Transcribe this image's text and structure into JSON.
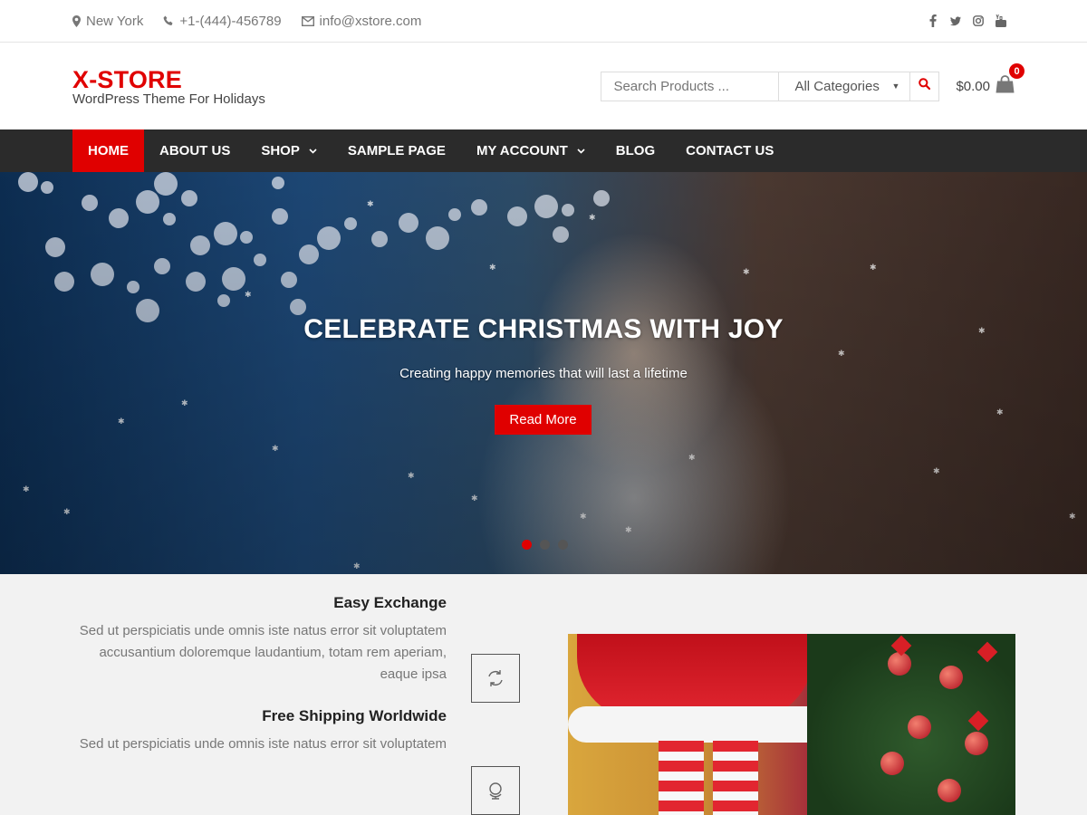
{
  "topbar": {
    "location": "New York",
    "phone": "+1-(444)-456789",
    "email": "info@xstore.com",
    "social": [
      "facebook-icon",
      "twitter-icon",
      "instagram-icon",
      "youtube-icon"
    ]
  },
  "header": {
    "logo": "X-STORE",
    "tagline": "WordPress Theme For Holidays",
    "search_placeholder": "Search Products ...",
    "category": "All Categories",
    "cart_total": "$0.00",
    "cart_count": "0"
  },
  "nav": {
    "items": [
      {
        "label": "Home"
      },
      {
        "label": "About Us"
      },
      {
        "label": "Shop"
      },
      {
        "label": "Sample Page"
      },
      {
        "label": "My Account"
      },
      {
        "label": "Blog"
      },
      {
        "label": "Contact Us"
      }
    ]
  },
  "hero": {
    "title": "CELEBRATE CHRISTMAS WITH JOY",
    "subtitle": "Creating happy memories that will last a lifetime",
    "button": "Read More"
  },
  "features": [
    {
      "title": "Easy Exchange",
      "text": "Sed ut perspiciatis unde omnis iste natus error sit voluptatem accusantium doloremque laudantium, totam rem aperiam, eaque ipsa",
      "icon": "exchange-icon"
    },
    {
      "title": "Free Shipping Worldwide",
      "text": "Sed ut perspiciatis unde omnis iste natus error sit voluptatem",
      "icon": "globe-icon"
    }
  ],
  "colors": {
    "accent": "#e00000",
    "nav_bg": "#2b2b2b",
    "features_bg": "#f2f2f2"
  }
}
